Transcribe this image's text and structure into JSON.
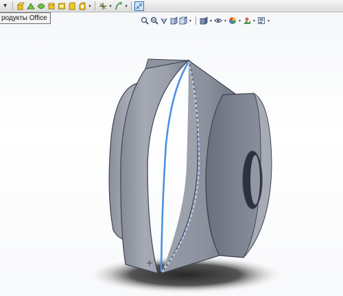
{
  "tooltip": {
    "text": "родукты Office"
  },
  "toolbar": {
    "icons": [
      "new-doc-icon",
      "open-icon",
      "assembly-icon",
      "part-icon",
      "cylinder-icon",
      "save-icon",
      "print-icon",
      "options-icon",
      "relations-icon",
      "display-pane-icon"
    ]
  },
  "viewbar": {
    "icons": [
      "zoom-to-fit-icon",
      "zoom-area-icon",
      "previous-view-icon",
      "section-view-icon",
      "view-orientation-icon",
      "display-style-icon",
      "hide-show-icon",
      "appearance-icon",
      "scene-icon",
      "view-settings-icon"
    ]
  },
  "colors": {
    "part_face": "#9da2ad",
    "part_dark": "#5c6170",
    "selection_edge": "#4a90e2",
    "toolbar_bg": "#e4e4e4"
  }
}
